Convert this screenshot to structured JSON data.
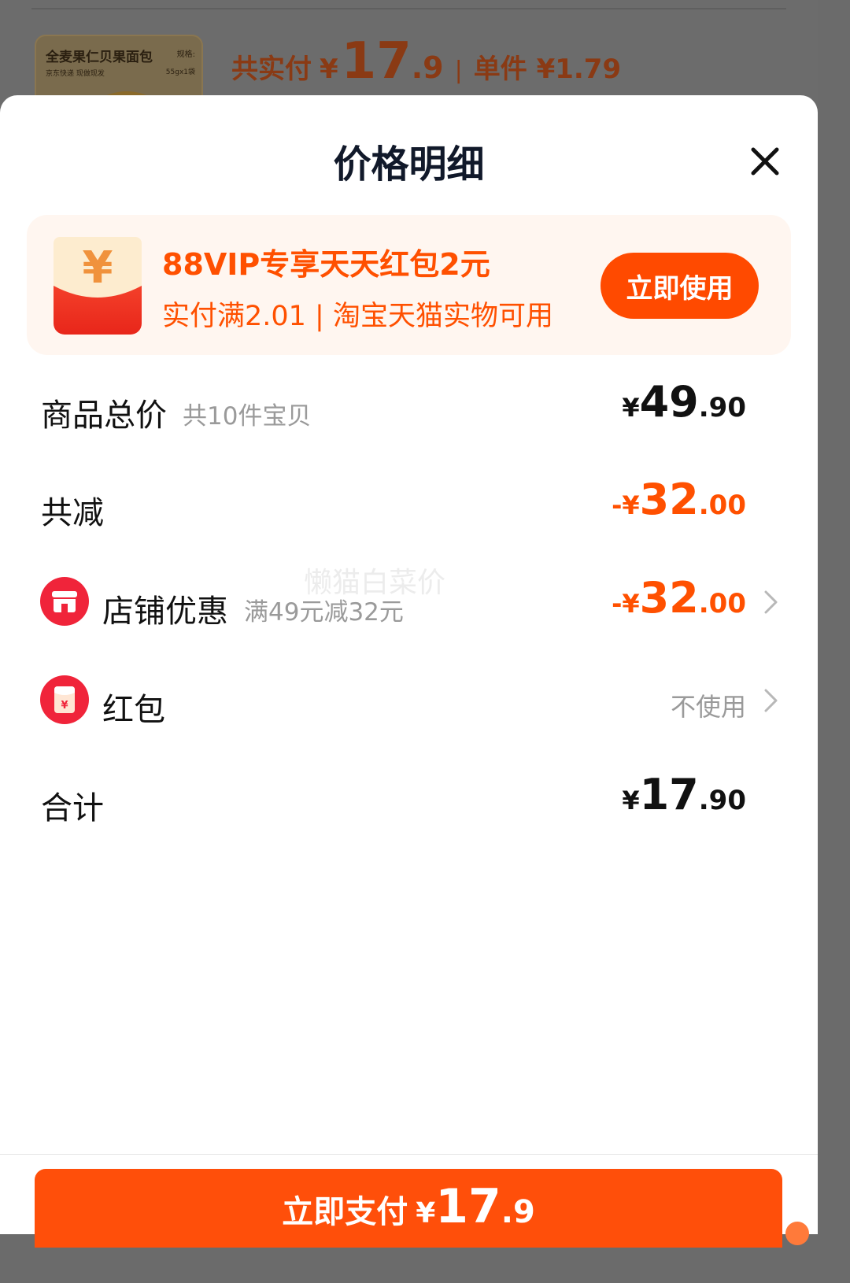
{
  "background": {
    "product": {
      "name": "全麦果仁贝果面包",
      "spec_label": "规格:",
      "tags": "京东快递  现做现发",
      "weight": "55gx1袋"
    },
    "paid_label": "共实付",
    "paid_yen": "¥",
    "paid_int": "17",
    "paid_dec": ".9",
    "separator": "|",
    "unit_price": "单件 ¥1.79"
  },
  "sheet": {
    "title": "价格明细",
    "close_icon": "close-icon"
  },
  "vip": {
    "title": "88VIP专享天天红包2元",
    "subtitle": "实付满2.01 | 淘宝天猫实物可用",
    "button": "立即使用",
    "icon": "red-packet-icon",
    "icon_glyph": "¥"
  },
  "rows": {
    "subtotal": {
      "label": "商品总价",
      "sub": "共10件宝贝",
      "sym": "¥",
      "int": "49",
      "dec": ".90"
    },
    "total_discount": {
      "label": "共减",
      "sym": "-¥",
      "int": "32",
      "dec": ".00"
    },
    "store_discount": {
      "label": "店铺优惠",
      "sub": "满49元减32元",
      "sym": "-¥",
      "int": "32",
      "dec": ".00",
      "icon": "store-icon"
    },
    "red_packet": {
      "label": "红包",
      "status": "不使用",
      "icon": "red-packet-icon",
      "icon_glyph": "¥"
    },
    "total": {
      "label": "合计",
      "sym": "¥",
      "int": "17",
      "dec": ".90"
    }
  },
  "watermark": "懒猫白菜价",
  "pay": {
    "label": "立即支付",
    "sym": "¥",
    "int": "17",
    "dec": ".9"
  },
  "colors": {
    "accent": "#ff5000",
    "button": "#ff4a00",
    "banner_bg": "#fff6f0",
    "text_dark": "#111111",
    "text_muted": "#9a9a9a"
  }
}
